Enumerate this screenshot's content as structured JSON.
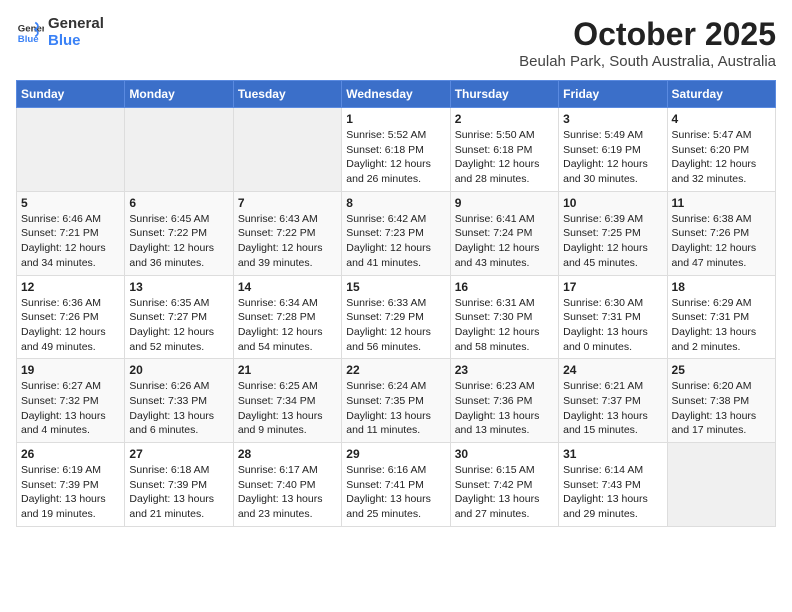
{
  "header": {
    "logo_line1": "General",
    "logo_line2": "Blue",
    "title": "October 2025",
    "subtitle": "Beulah Park, South Australia, Australia"
  },
  "days_of_week": [
    "Sunday",
    "Monday",
    "Tuesday",
    "Wednesday",
    "Thursday",
    "Friday",
    "Saturday"
  ],
  "weeks": [
    [
      {
        "day": "",
        "content": ""
      },
      {
        "day": "",
        "content": ""
      },
      {
        "day": "",
        "content": ""
      },
      {
        "day": "1",
        "content": "Sunrise: 5:52 AM\nSunset: 6:18 PM\nDaylight: 12 hours\nand 26 minutes."
      },
      {
        "day": "2",
        "content": "Sunrise: 5:50 AM\nSunset: 6:18 PM\nDaylight: 12 hours\nand 28 minutes."
      },
      {
        "day": "3",
        "content": "Sunrise: 5:49 AM\nSunset: 6:19 PM\nDaylight: 12 hours\nand 30 minutes."
      },
      {
        "day": "4",
        "content": "Sunrise: 5:47 AM\nSunset: 6:20 PM\nDaylight: 12 hours\nand 32 minutes."
      }
    ],
    [
      {
        "day": "5",
        "content": "Sunrise: 6:46 AM\nSunset: 7:21 PM\nDaylight: 12 hours\nand 34 minutes."
      },
      {
        "day": "6",
        "content": "Sunrise: 6:45 AM\nSunset: 7:22 PM\nDaylight: 12 hours\nand 36 minutes."
      },
      {
        "day": "7",
        "content": "Sunrise: 6:43 AM\nSunset: 7:22 PM\nDaylight: 12 hours\nand 39 minutes."
      },
      {
        "day": "8",
        "content": "Sunrise: 6:42 AM\nSunset: 7:23 PM\nDaylight: 12 hours\nand 41 minutes."
      },
      {
        "day": "9",
        "content": "Sunrise: 6:41 AM\nSunset: 7:24 PM\nDaylight: 12 hours\nand 43 minutes."
      },
      {
        "day": "10",
        "content": "Sunrise: 6:39 AM\nSunset: 7:25 PM\nDaylight: 12 hours\nand 45 minutes."
      },
      {
        "day": "11",
        "content": "Sunrise: 6:38 AM\nSunset: 7:26 PM\nDaylight: 12 hours\nand 47 minutes."
      }
    ],
    [
      {
        "day": "12",
        "content": "Sunrise: 6:36 AM\nSunset: 7:26 PM\nDaylight: 12 hours\nand 49 minutes."
      },
      {
        "day": "13",
        "content": "Sunrise: 6:35 AM\nSunset: 7:27 PM\nDaylight: 12 hours\nand 52 minutes."
      },
      {
        "day": "14",
        "content": "Sunrise: 6:34 AM\nSunset: 7:28 PM\nDaylight: 12 hours\nand 54 minutes."
      },
      {
        "day": "15",
        "content": "Sunrise: 6:33 AM\nSunset: 7:29 PM\nDaylight: 12 hours\nand 56 minutes."
      },
      {
        "day": "16",
        "content": "Sunrise: 6:31 AM\nSunset: 7:30 PM\nDaylight: 12 hours\nand 58 minutes."
      },
      {
        "day": "17",
        "content": "Sunrise: 6:30 AM\nSunset: 7:31 PM\nDaylight: 13 hours\nand 0 minutes."
      },
      {
        "day": "18",
        "content": "Sunrise: 6:29 AM\nSunset: 7:31 PM\nDaylight: 13 hours\nand 2 minutes."
      }
    ],
    [
      {
        "day": "19",
        "content": "Sunrise: 6:27 AM\nSunset: 7:32 PM\nDaylight: 13 hours\nand 4 minutes."
      },
      {
        "day": "20",
        "content": "Sunrise: 6:26 AM\nSunset: 7:33 PM\nDaylight: 13 hours\nand 6 minutes."
      },
      {
        "day": "21",
        "content": "Sunrise: 6:25 AM\nSunset: 7:34 PM\nDaylight: 13 hours\nand 9 minutes."
      },
      {
        "day": "22",
        "content": "Sunrise: 6:24 AM\nSunset: 7:35 PM\nDaylight: 13 hours\nand 11 minutes."
      },
      {
        "day": "23",
        "content": "Sunrise: 6:23 AM\nSunset: 7:36 PM\nDaylight: 13 hours\nand 13 minutes."
      },
      {
        "day": "24",
        "content": "Sunrise: 6:21 AM\nSunset: 7:37 PM\nDaylight: 13 hours\nand 15 minutes."
      },
      {
        "day": "25",
        "content": "Sunrise: 6:20 AM\nSunset: 7:38 PM\nDaylight: 13 hours\nand 17 minutes."
      }
    ],
    [
      {
        "day": "26",
        "content": "Sunrise: 6:19 AM\nSunset: 7:39 PM\nDaylight: 13 hours\nand 19 minutes."
      },
      {
        "day": "27",
        "content": "Sunrise: 6:18 AM\nSunset: 7:39 PM\nDaylight: 13 hours\nand 21 minutes."
      },
      {
        "day": "28",
        "content": "Sunrise: 6:17 AM\nSunset: 7:40 PM\nDaylight: 13 hours\nand 23 minutes."
      },
      {
        "day": "29",
        "content": "Sunrise: 6:16 AM\nSunset: 7:41 PM\nDaylight: 13 hours\nand 25 minutes."
      },
      {
        "day": "30",
        "content": "Sunrise: 6:15 AM\nSunset: 7:42 PM\nDaylight: 13 hours\nand 27 minutes."
      },
      {
        "day": "31",
        "content": "Sunrise: 6:14 AM\nSunset: 7:43 PM\nDaylight: 13 hours\nand 29 minutes."
      },
      {
        "day": "",
        "content": ""
      }
    ]
  ]
}
